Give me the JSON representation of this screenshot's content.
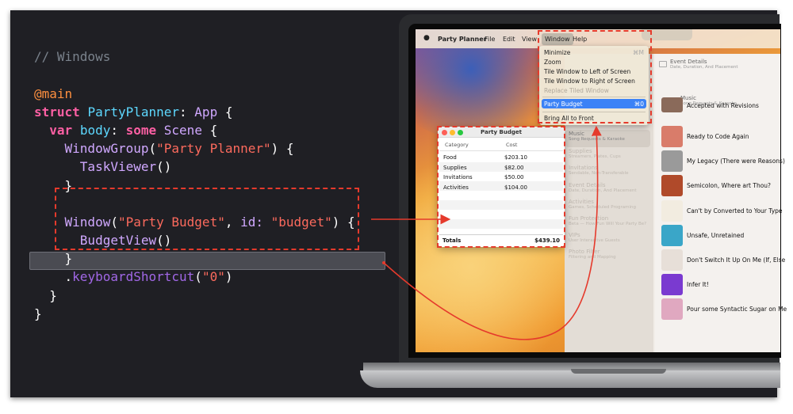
{
  "code": {
    "comment": "// Windows",
    "attribute": "@main",
    "kw_struct": "struct",
    "type_name": "PartyPlanner",
    "colon": ": ",
    "protocol_app": "App",
    "open_brace": " {",
    "kw_var": "var",
    "body_name": "body",
    "kw_some": "some",
    "scene_type": "Scene",
    "window_group": "WindowGroup",
    "window_group_title": "\"Party Planner\"",
    "task_viewer": "TaskViewer",
    "window_ctor": "Window",
    "window_title": "\"Party Budget\"",
    "id_label": "id:",
    "window_id": "\"budget\"",
    "budget_view": "BudgetView",
    "modifier": "keyboardShortcut",
    "shortcut_key": "\"0\"",
    "parens": "()",
    "close_brace": "}",
    "open_paren": "(",
    "close_paren": ")",
    "close_paren_brace": ") {",
    "comma": ", ",
    "dot": "."
  },
  "menubar": {
    "apple_icon": "apple-logo-icon",
    "app_name": "Party Planner",
    "items": [
      "File",
      "Edit",
      "View",
      "Window",
      "Help"
    ]
  },
  "window_menu": {
    "items": [
      {
        "label": "Minimize",
        "shortcut": "⌘M"
      },
      {
        "label": "Zoom",
        "shortcut": ""
      },
      {
        "label": "Tile Window to Left of Screen",
        "shortcut": ""
      },
      {
        "label": "Tile Window to Right of Screen",
        "shortcut": ""
      },
      {
        "label": "Replace Tiled Window",
        "shortcut": ""
      },
      {
        "label": "Party Budget",
        "shortcut": "⌘0"
      },
      {
        "label": "Bring All to Front",
        "shortcut": ""
      }
    ]
  },
  "budget_window": {
    "title": "Party Budget",
    "col_category": "Category",
    "col_cost": "Cost",
    "rows": [
      {
        "category": "Food",
        "cost": "$203.10"
      },
      {
        "category": "Supplies",
        "cost": "$82.00"
      },
      {
        "category": "Invitations",
        "cost": "$50.00"
      },
      {
        "category": "Activities",
        "cost": "$104.00"
      }
    ],
    "total_label": "Totals",
    "total_value": "$439.10"
  },
  "task_viewer": {
    "sidebar": [
      {
        "title": "Music",
        "subtitle": "Song Requests & Karaoke"
      },
      {
        "title": "Supplies",
        "subtitle": "Streamers, Plates, Cups"
      },
      {
        "title": "Invitations",
        "subtitle": "Sendable, Non-Transferable"
      },
      {
        "title": "Event Details",
        "subtitle": "Date, Duration, And Placement"
      },
      {
        "title": "Activities",
        "subtitle": "Games, Scheduled Programing"
      },
      {
        "title": "Fun Protection",
        "subtitle": "Beta — How Fun Will Your Party Be?"
      },
      {
        "title": "VIPs",
        "subtitle": "User Interactive Guests"
      },
      {
        "title": "Photo Filter",
        "subtitle": "Filtering and Mapping"
      }
    ],
    "header_event": {
      "title": "Event Details",
      "subtitle": "Date, Duration, And Placement"
    },
    "header_music": {
      "title": "Music",
      "subtitle": "Song Requests & Karaoke"
    },
    "songs": [
      "Accepted with Revisions",
      "Ready to Code Again",
      "My Legacy (There were Reasons)",
      "Semicolon, Where art Thou?",
      "Can't by Converted to Your Type",
      "Unsafe, Unretained",
      "Don't Switch It Up On Me (If, Else",
      "Infer It!",
      "Pour some Syntactic Sugar on Me"
    ]
  },
  "colors": {
    "annotation_red": "#e53a2c",
    "code_bg": "#1f1f24",
    "keyword": "#fc5fa3",
    "string": "#fc6a5d",
    "type": "#5dd8ff",
    "menu_highlight": "#3b82f6"
  }
}
